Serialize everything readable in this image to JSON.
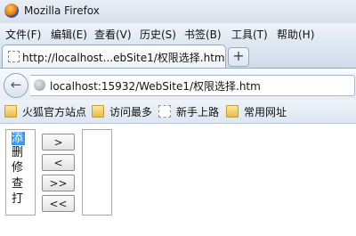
{
  "window": {
    "title": "Mozilla Firefox",
    "icon": "firefox-icon"
  },
  "menu": [
    "文件(F)",
    "编辑(E)",
    "查看(V)",
    "历史(S)",
    "书签(B)",
    "工具(T)",
    "帮助(H)"
  ],
  "tab": {
    "title": "http://localhost...ebSite1/权限选择.htm",
    "new_tab_label": "+"
  },
  "nav": {
    "url": "localhost:15932/WebSite1/权限选择.htm",
    "back_glyph": "←"
  },
  "bookmarks": [
    {
      "label": "火狐官方站点",
      "icon": "folder-icon"
    },
    {
      "label": "访问最多",
      "icon": "folder-icon"
    },
    {
      "label": "新手上路",
      "icon": "page-icon"
    },
    {
      "label": "常用网址",
      "icon": "folder-icon"
    }
  ],
  "left_list": {
    "items": [
      "添",
      "删",
      "修",
      "查",
      "打"
    ],
    "selected_index": 0
  },
  "right_list": {
    "items": []
  },
  "buttons": {
    "move_right": ">",
    "move_left": "<",
    "move_all_right": ">>",
    "move_all_left": "<<"
  }
}
